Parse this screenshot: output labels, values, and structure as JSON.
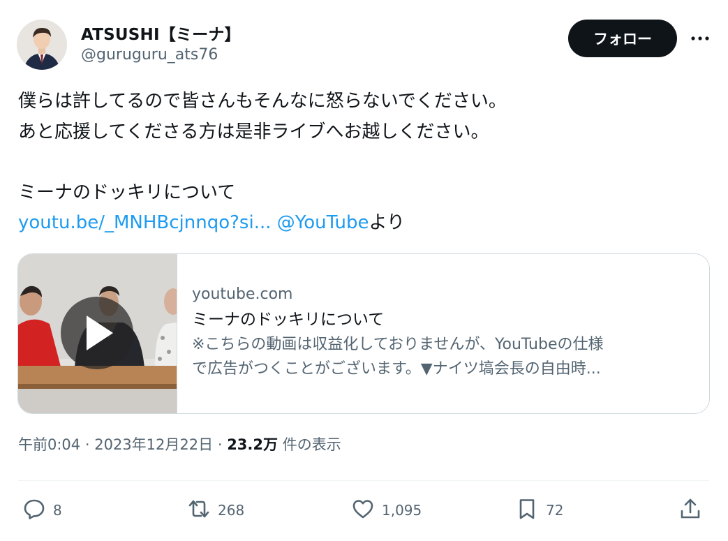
{
  "user": {
    "display_name": "ATSUSHI【ミーナ】",
    "handle": "@guruguru_ats76",
    "follow_label": "フォロー"
  },
  "tweet": {
    "line1": "僕らは許してるので皆さんもそんなに怒らないでください。",
    "line2": "あと応援してくださる方は是非ライブへお越しください。",
    "line3": "ミーナのドッキリについて",
    "link_text": "youtu.be/_MNHBcjnnqo?si...",
    "mention_text": "@YouTube",
    "suffix_text": "より"
  },
  "card": {
    "domain": "youtube.com",
    "title": "ミーナのドッキリについて",
    "desc_line1": "※こちらの動画は収益化しておりませんが、YouTubeの仕様",
    "desc_line2": "で広告がつくことがございます。▼ナイツ塙会長の自由時..."
  },
  "meta": {
    "time": "午前0:04",
    "sep": "·",
    "date": "2023年12月22日",
    "views": "23.2万",
    "views_label": "件の表示"
  },
  "actions": {
    "replies": "8",
    "reposts": "268",
    "likes": "1,095",
    "bookmarks": "72"
  },
  "icons": [
    "more-icon",
    "play-icon",
    "reply-icon",
    "repost-icon",
    "like-icon",
    "bookmark-icon",
    "share-icon"
  ]
}
